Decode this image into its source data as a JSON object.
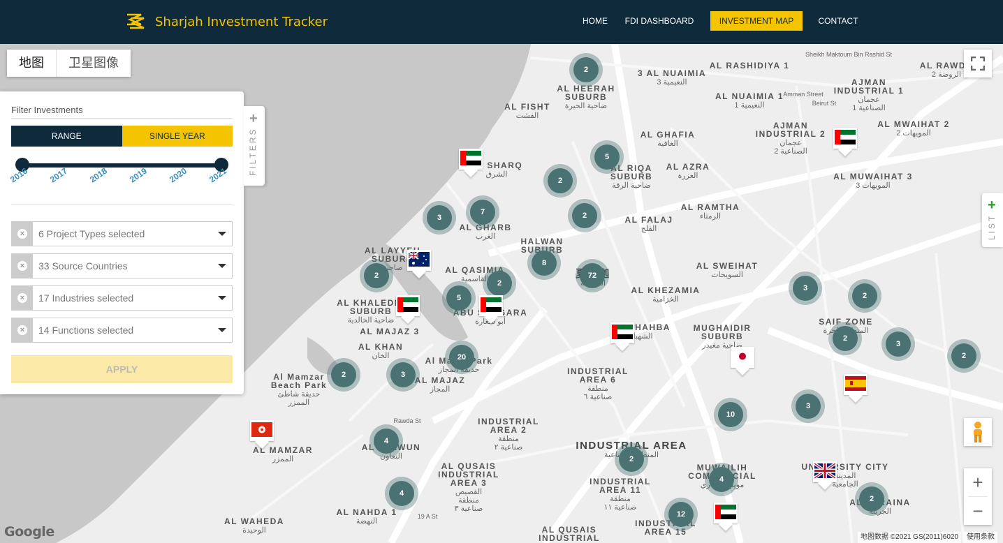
{
  "header": {
    "title": "Sharjah Investment Tracker",
    "nav": [
      {
        "label": "HOME",
        "active": false
      },
      {
        "label": "FDI DASHBOARD",
        "active": false
      },
      {
        "label": "INVESTMENT MAP",
        "active": true
      },
      {
        "label": "CONTACT",
        "active": false
      }
    ],
    "colors": {
      "bar": "#0e2a3b",
      "accent": "#f5c400"
    }
  },
  "map_type": {
    "map": "地图",
    "satellite": "卫星图像"
  },
  "filters": {
    "title": "Filter Investments",
    "modes": {
      "range": "RANGE",
      "single": "SINGLE YEAR"
    },
    "years": [
      "2016",
      "2017",
      "2018",
      "2019",
      "2020",
      "2021"
    ],
    "selected_range": [
      "2016",
      "2021"
    ],
    "selects": [
      {
        "label": "6 Project Types selected"
      },
      {
        "label": "33 Source Countries"
      },
      {
        "label": "17 Industries selected"
      },
      {
        "label": "14 Functions selected"
      }
    ],
    "apply": "APPLY",
    "tab_label": "FILTERS",
    "tab_icon": "plus-icon"
  },
  "list_tab": {
    "label": "LIST",
    "icon": "plus-icon"
  },
  "places": [
    {
      "en": "AL HEERAH\nSUBURB",
      "ar": "ضاحية الحيرة"
    },
    {
      "en": "3 AL NUAIMIA",
      "ar": "3 النعيمية"
    },
    {
      "en": "AL RASHIDIYA 1",
      "ar": ""
    },
    {
      "en": "AL RAWDA",
      "ar": "الروضة 2"
    },
    {
      "en": "AL FISHT",
      "ar": "الفشت"
    },
    {
      "en": "AL NUAIMIA 1",
      "ar": "النعيمية 1"
    },
    {
      "en": "AJMAN\nINDUSTRIAL 1",
      "ar": "عجمان\nالصناعية 1"
    },
    {
      "en": "AL GHAFIA",
      "ar": "الغافية"
    },
    {
      "en": "AJMAN\nINDUSTRIAL 2",
      "ar": "عجمان\nالصناعية 2"
    },
    {
      "en": "AL MWAIHAT 2",
      "ar": "المويهات 2"
    },
    {
      "en": "AL SHARQ",
      "ar": "الشرق"
    },
    {
      "en": "AL RIQA\nSUBURB",
      "ar": "ضاحية الرقة"
    },
    {
      "en": "AL AZRA",
      "ar": "العزرة"
    },
    {
      "en": "AL MUWAIHAT 3",
      "ar": "المويهات 3"
    },
    {
      "en": "AL RAMTHA",
      "ar": "الرمثاء"
    },
    {
      "en": "AL GHARB",
      "ar": "الغرب"
    },
    {
      "en": "AL FALAJ",
      "ar": "الفلج"
    },
    {
      "en": "HALWAN\nSUBURB",
      "ar": ""
    },
    {
      "en": "AL LAYYEH\nSUBURB",
      "ar": "ضاحية"
    },
    {
      "en": "AL QASIMIA",
      "ar": "القاسمية"
    },
    {
      "en": "AL SWEIHAT",
      "ar": "السويحات"
    },
    {
      "en": "AL KHEZAMIA",
      "ar": "الخزامية"
    },
    {
      "en": "AL KHALEDIA\nSUBURB",
      "ar": "ضاحية الخالدية"
    },
    {
      "en": "ABU SHAGARA",
      "ar": "أبو شغارة"
    },
    {
      "en": "AL SHAHBA",
      "ar": "الشهباء"
    },
    {
      "en": "MUGHAIDIR\nSUBURB",
      "ar": "ضاحية مغيدر"
    },
    {
      "en": "SAIF ZONE",
      "ar": "المنطقة الحرة"
    },
    {
      "en": "AL MAJAZ 3",
      "ar": ""
    },
    {
      "en": "AL KHAN",
      "ar": "الخان"
    },
    {
      "en": "Al Majaz Park",
      "ar": "حديقة المجاز"
    },
    {
      "en": "AL MAJAZ",
      "ar": "المجاز"
    },
    {
      "en": "INDUSTRIAL\nAREA 6",
      "ar": "منطقة\nصناعية ٦"
    },
    {
      "en": "Al Mamzar\nBeach Park",
      "ar": "حديقة شاطئ\nالممزر"
    },
    {
      "en": "INDUSTRIAL\nAREA 2",
      "ar": "منطقة\nصناعية ٢"
    },
    {
      "en": "AL MAMZAR",
      "ar": "الممزر"
    },
    {
      "en": "AL TAAWUN",
      "ar": "التعاون"
    },
    {
      "en": "INDUSTRIAL AREA",
      "ar": "المنطقة الصناعية"
    },
    {
      "en": "MUWAILIH\nCOMMERCIAL",
      "ar": "مويلح التجاري"
    },
    {
      "en": "UNIVERSITY CITY",
      "ar": "المدينة\nالجامعية"
    },
    {
      "en": "AL QUSAIS\nINDUSTRIAL\nAREA 3",
      "ar": "القصيص\nمنطقة\nصناعية ٣"
    },
    {
      "en": "INDUSTRIAL\nAREA 11",
      "ar": "منطقة\nصناعية ١١"
    },
    {
      "en": "AL JURAINA",
      "ar": "الجرينة"
    },
    {
      "en": "AL NAHDA 1",
      "ar": "النهضة"
    },
    {
      "en": "AL WAHEDA",
      "ar": "الوحيدة"
    },
    {
      "en": "INDUSTRIAL\nAREA 15",
      "ar": ""
    },
    {
      "en": "AL QUSAIS\nINDUSTRIAL",
      "ar": ""
    },
    {
      "en": "Sheikh Maktoum Bin Rashid St",
      "ar": ""
    },
    {
      "en": "Amman Street",
      "ar": ""
    },
    {
      "en": "Beirut St",
      "ar": ""
    },
    {
      "en": "Rawda St",
      "ar": ""
    },
    {
      "en": "19 A St",
      "ar": ""
    },
    {
      "en": "夏尔迦",
      "ar": "الشارقة"
    }
  ],
  "clusters": [
    "2",
    "5",
    "2",
    "2",
    "3",
    "7",
    "8",
    "72",
    "2",
    "2",
    "5",
    "3",
    "2",
    "2",
    "3",
    "2",
    "20",
    "2",
    "3",
    "3",
    "10",
    "4",
    "2",
    "4",
    "12",
    "2",
    "4"
  ],
  "flag_pins": [
    {
      "country": "UAE",
      "icon": "uae-flag-icon"
    },
    {
      "country": "UAE",
      "icon": "uae-flag-icon"
    },
    {
      "country": "Australia",
      "icon": "australia-flag-icon"
    },
    {
      "country": "UAE",
      "icon": "uae-flag-icon"
    },
    {
      "country": "UAE",
      "icon": "uae-flag-icon"
    },
    {
      "country": "UAE",
      "icon": "uae-flag-icon"
    },
    {
      "country": "Japan",
      "icon": "japan-flag-icon"
    },
    {
      "country": "Spain",
      "icon": "spain-flag-icon"
    },
    {
      "country": "Hong Kong",
      "icon": "hong-kong-flag-icon"
    },
    {
      "country": "United Kingdom",
      "icon": "uk-flag-icon"
    },
    {
      "country": "UAE",
      "icon": "uae-flag-icon"
    }
  ],
  "map_controls": {
    "fullscreen": "fullscreen-icon",
    "pegman": "pegman-icon",
    "zoom_in": "+",
    "zoom_out": "−"
  },
  "attribution": {
    "logo": "Google",
    "data": "地图数据 ©2021 GS(2011)6020",
    "terms": "使用条款"
  }
}
